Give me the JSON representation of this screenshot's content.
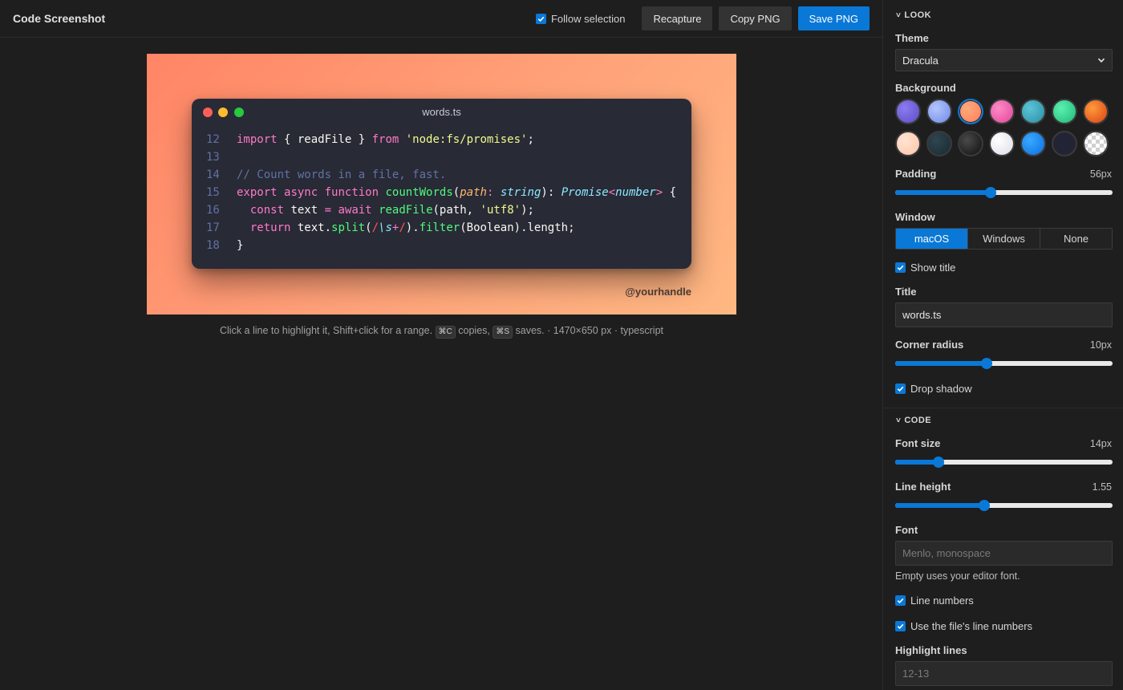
{
  "header": {
    "title": "Code Screenshot",
    "follow_label": "Follow selection",
    "recapture_label": "Recapture",
    "copy_label": "Copy PNG",
    "save_label": "Save PNG"
  },
  "preview": {
    "window_title": "words.ts",
    "handle": "@yourhandle",
    "lines": [
      {
        "n": "12",
        "tokens": [
          [
            "kw",
            "import"
          ],
          [
            "pl",
            " { readFile } "
          ],
          [
            "kw",
            "from"
          ],
          [
            "pl",
            " "
          ],
          [
            "str",
            "'node:fs/promises'"
          ],
          [
            "pl",
            ";"
          ]
        ]
      },
      {
        "n": "13",
        "tokens": []
      },
      {
        "n": "14",
        "tokens": [
          [
            "com",
            "// Count words in a file, fast."
          ]
        ]
      },
      {
        "n": "15",
        "tokens": [
          [
            "kw",
            "export"
          ],
          [
            "pl",
            " "
          ],
          [
            "kw",
            "async"
          ],
          [
            "pl",
            " "
          ],
          [
            "kw",
            "function"
          ],
          [
            "pl",
            " "
          ],
          [
            "fn",
            "countWords"
          ],
          [
            "pl",
            "("
          ],
          [
            "param",
            "path"
          ],
          [
            "kw",
            ":"
          ],
          [
            "pl",
            " "
          ],
          [
            "type",
            "string"
          ],
          [
            "pl",
            "): "
          ],
          [
            "type",
            "Promise"
          ],
          [
            "kw",
            "<"
          ],
          [
            "type",
            "number"
          ],
          [
            "kw",
            ">"
          ],
          [
            "pl",
            " {"
          ]
        ]
      },
      {
        "n": "16",
        "tokens": [
          [
            "pl",
            "  "
          ],
          [
            "kw",
            "const"
          ],
          [
            "pl",
            " text "
          ],
          [
            "kw",
            "="
          ],
          [
            "pl",
            " "
          ],
          [
            "kw",
            "await"
          ],
          [
            "pl",
            " "
          ],
          [
            "fn",
            "readFile"
          ],
          [
            "pl",
            "(path, "
          ],
          [
            "str",
            "'utf8'"
          ],
          [
            "pl",
            ");"
          ]
        ]
      },
      {
        "n": "17",
        "tokens": [
          [
            "pl",
            "  "
          ],
          [
            "kw",
            "return"
          ],
          [
            "pl",
            " text."
          ],
          [
            "fn",
            "split"
          ],
          [
            "pl",
            "("
          ],
          [
            "re",
            "/"
          ],
          [
            "type",
            "\\s"
          ],
          [
            "kw",
            "+"
          ],
          [
            "re",
            "/"
          ],
          [
            "pl",
            ")."
          ],
          [
            "fn",
            "filter"
          ],
          [
            "pl",
            "(Boolean).length;"
          ]
        ]
      },
      {
        "n": "18",
        "tokens": [
          [
            "pl",
            "}"
          ]
        ]
      }
    ]
  },
  "hint": {
    "part1": "Click a line to highlight it, Shift+click for a range.",
    "key_copy": "⌘C",
    "part2": "copies,",
    "key_save": "⌘S",
    "part3": "saves. · 1470×650 px · typescript"
  },
  "sidebar": {
    "look": {
      "heading": "LOOK",
      "theme_label": "Theme",
      "theme_value": "Dracula",
      "background_label": "Background",
      "swatches": [
        {
          "name": "indigo",
          "bg": "radial-gradient(circle at 35% 35%, #8c7cf0, #5b4bc7)"
        },
        {
          "name": "periwinkle",
          "bg": "radial-gradient(circle at 35% 35%, #b3c4ff, #6f8ae6)"
        },
        {
          "name": "peach",
          "bg": "radial-gradient(circle at 35% 35%, #ffab7a, #ff7a5c)",
          "selected": true
        },
        {
          "name": "pink",
          "bg": "radial-gradient(circle at 35% 35%, #ff8ac6, #e0459a)"
        },
        {
          "name": "teal",
          "bg": "radial-gradient(circle at 35% 35%, #5cc3d6, #2a8ea3)"
        },
        {
          "name": "mint",
          "bg": "radial-gradient(circle at 35% 35%, #5cf0b0, #1fb877)"
        },
        {
          "name": "orange",
          "bg": "radial-gradient(circle at 35% 35%, #ff9a3c, #d9420f)"
        },
        {
          "name": "cream",
          "bg": "radial-gradient(circle at 35% 35%, #ffe4d2, #ffc4a8)"
        },
        {
          "name": "slate",
          "bg": "radial-gradient(circle at 35% 35%, #2f4650, #182a30)"
        },
        {
          "name": "charcoal",
          "bg": "radial-gradient(circle at 35% 35%, #4a4a4a, #0f0f0f)"
        },
        {
          "name": "white",
          "bg": "radial-gradient(circle at 35% 35%, #ffffff, #dcdde6)"
        },
        {
          "name": "blue",
          "bg": "radial-gradient(circle at 35% 35%, #3aa8ff, #0a6fe0)"
        },
        {
          "name": "navy",
          "bg": "#232336"
        },
        {
          "name": "transparent",
          "bg": "repeating-conic-gradient(#d0d0d0 0% 25%, #ffffff 0% 50%) 50% / 10px 10px"
        }
      ],
      "padding_label": "Padding",
      "padding_value": "56px",
      "padding_fraction": 0.44,
      "window_label": "Window",
      "window_options": [
        "macOS",
        "Windows",
        "None"
      ],
      "window_selected": "macOS",
      "show_title_label": "Show title",
      "title_label": "Title",
      "title_value": "words.ts",
      "radius_label": "Corner radius",
      "radius_value": "10px",
      "radius_fraction": 0.42,
      "shadow_label": "Drop shadow"
    },
    "code": {
      "heading": "CODE",
      "font_size_label": "Font size",
      "font_size_value": "14px",
      "font_size_fraction": 0.2,
      "line_height_label": "Line height",
      "line_height_value": "1.55",
      "line_height_fraction": 0.41,
      "font_label": "Font",
      "font_placeholder": "Menlo, monospace",
      "font_help": "Empty uses your editor font.",
      "line_numbers_label": "Line numbers",
      "file_numbers_label": "Use the file's line numbers",
      "highlight_label": "Highlight lines",
      "highlight_placeholder": "12-13"
    }
  }
}
